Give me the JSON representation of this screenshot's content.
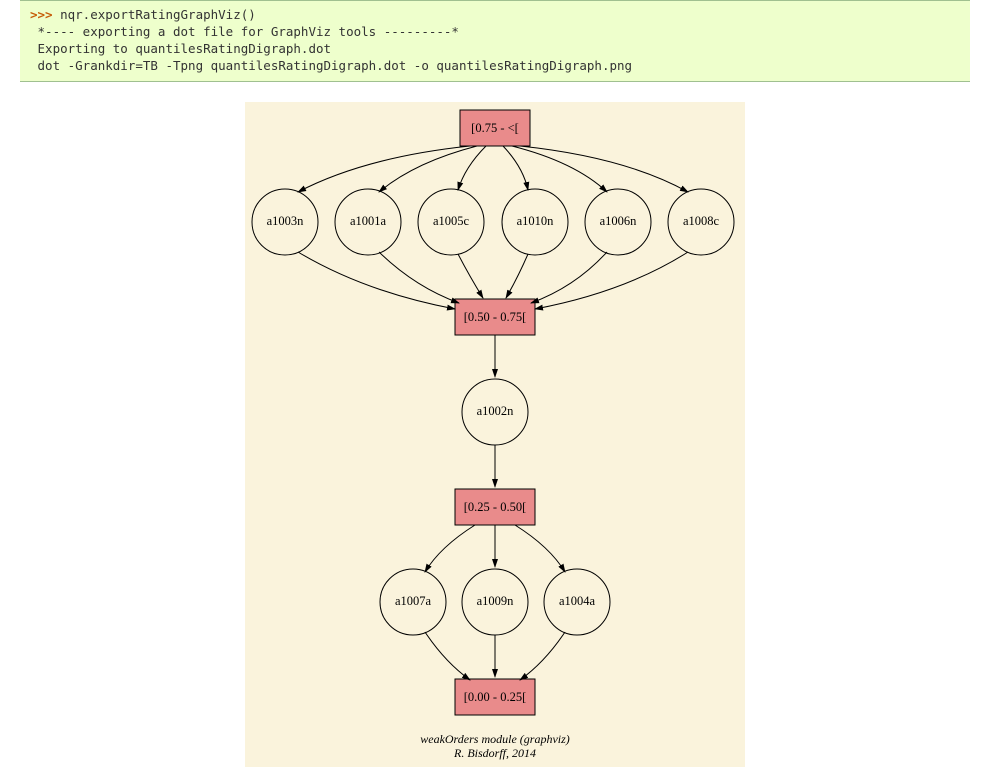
{
  "code": {
    "prompt": ">>> ",
    "command": "nqr.exportRatingGraphViz()",
    "out1": " *---- exporting a dot file for GraphViz tools ---------*",
    "out2": " Exporting to quantilesRatingDigraph.dot",
    "out3": " dot -Grankdir=TB -Tpng quantilesRatingDigraph.dot -o quantilesRatingDigraph.png"
  },
  "graph": {
    "level0": {
      "label": "[0.75 - <["
    },
    "row1": [
      "a1003n",
      "a1001a",
      "a1005c",
      "a1010n",
      "a1006n",
      "a1008c"
    ],
    "level1": {
      "label": "[0.50 - 0.75["
    },
    "mid": {
      "label": "a1002n"
    },
    "level2": {
      "label": "[0.25 - 0.50["
    },
    "row2": [
      "a1007a",
      "a1009n",
      "a1004a"
    ],
    "level3": {
      "label": "[0.00 - 0.25["
    }
  },
  "caption": {
    "line1": "weakOrders module (graphviz)",
    "line2": "R. Bisdorff, 2014"
  }
}
